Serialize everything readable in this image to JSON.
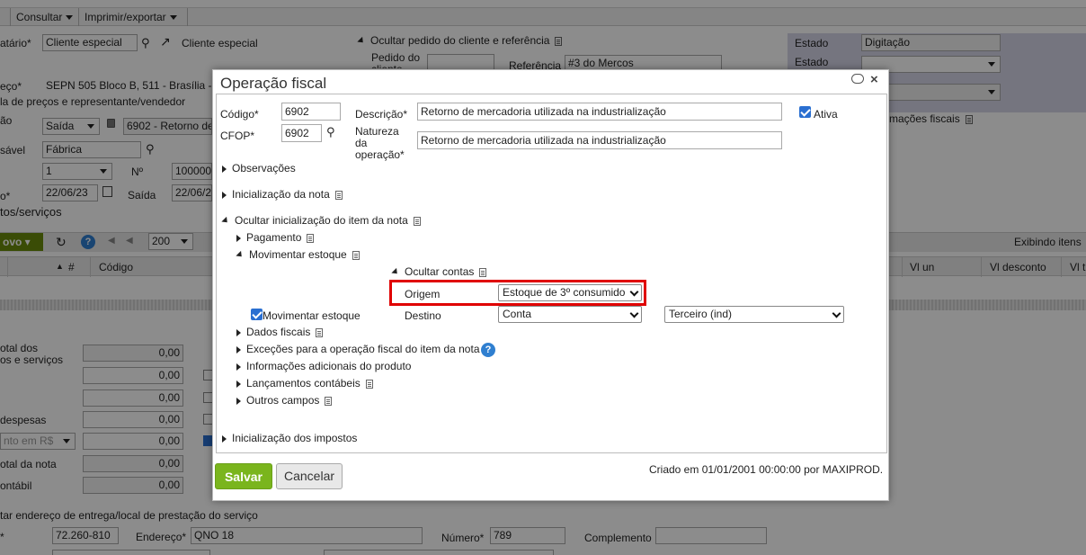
{
  "background": {
    "toolbar": {
      "consultar": "Consultar",
      "imprimir": "Imprimir/exportar"
    },
    "destinatario_label": "atário*",
    "destinatario_value": "Cliente especial",
    "destinatario_link": "Cliente especial",
    "endereco_label": "eço*",
    "endereco_value": "SEPN 505 Bloco B, 511 - Brasília -",
    "tabela_precos": "la de preços e representante/vendedor",
    "operacao_label": "ão",
    "operacao_tipo": "Saída",
    "operacao_value": "6902 - Retorno de",
    "responsavel_label": "sável",
    "responsavel_value": "Fábrica",
    "serie_value": "1",
    "numero_label": "Nº",
    "numero_value": "100000",
    "data_label": "o*",
    "data_value": "22/06/23",
    "saida_label": "Saída",
    "saida_value": "22/06/2",
    "produtos_title": "tos/serviços",
    "ocultar_pedido": "Ocultar pedido do cliente e referência",
    "pedido_label": "Pedido do cliente",
    "referencia_label": "Referência",
    "referencia_value": "#3 do Mercos",
    "estado_label": "Estado",
    "estado_value": "Digitação",
    "estado2_label": "Estado",
    "informacoes_fiscais": "rmações fiscais",
    "grid": {
      "novo": "ovo",
      "page_size": "200",
      "exibindo": "Exibindo itens",
      "col_num": "#",
      "col_codigo": "Código",
      "col_vl_un": "Vl un",
      "col_vl_desconto": "Vl desconto",
      "col_vl_t": "Vl t"
    },
    "totals": {
      "total_produtos_l1": "otal dos",
      "total_produtos_l2": "os e serviços",
      "despesas": "despesas",
      "desconto_placeholder": "nto em R$",
      "total_nota": "otal da nota",
      "contabil": "ontábil",
      "values": [
        "0,00",
        "0,00",
        "0,00",
        "0,00",
        "0,00",
        "0,00",
        "0,00"
      ]
    },
    "entrega_title": "tar endereço de entrega/local de prestação do serviço",
    "cep_value": "72.260-810",
    "endereco2_label": "Endereço*",
    "endereco2_value": "QNO 18",
    "numero2_label": "Número*",
    "numero2_value": "789",
    "complemento_label": "Complemento"
  },
  "dialog": {
    "title": "Operação fiscal",
    "codigo_label": "Código*",
    "codigo_value": "6902",
    "cfop_label": "CFOP*",
    "cfop_value": "6902",
    "descricao_label": "Descrição*",
    "descricao_value": "Retorno de mercadoria utilizada na industrialização",
    "natureza_label_1": "Natureza",
    "natureza_label_2": "da",
    "natureza_label_3": "operação*",
    "natureza_value": "Retorno de mercadoria utilizada na industrialização",
    "ativa_label": "Ativa",
    "ativa_checked": true,
    "sections": {
      "observacoes": "Observações",
      "inicializacao_nota": "Inicialização da nota",
      "ocultar_inicializacao_item": "Ocultar inicialização do item da nota",
      "pagamento": "Pagamento",
      "movimentar_estoque": "Movimentar estoque",
      "ocultar_contas": "Ocultar contas",
      "dados_fiscais": "Dados fiscais",
      "excecoes": "Exceções para a operação fiscal do item da nota",
      "informacoes_adicionais": "Informações adicionais do produto",
      "lancamentos_contabeis": "Lançamentos contábeis",
      "outros_campos": "Outros campos",
      "inicializacao_impostos": "Inicialização dos impostos"
    },
    "origem_label": "Origem",
    "origem_value": "Estoque de 3º consumido",
    "movimentar_checkbox_label": "Movimentar estoque",
    "movimentar_checked": true,
    "destino_label": "Destino",
    "destino_value": "Conta",
    "destino2_value": "Terceiro (ind)",
    "salvar": "Salvar",
    "cancelar": "Cancelar",
    "footer": "Criado em 01/01/2001 00:00:00 por MAXIPROD."
  },
  "colors": {
    "salvar": "#7ab51d",
    "highlight": "#e00000",
    "checkbox": "#2a6fd1",
    "help": "#2f7fd0"
  }
}
